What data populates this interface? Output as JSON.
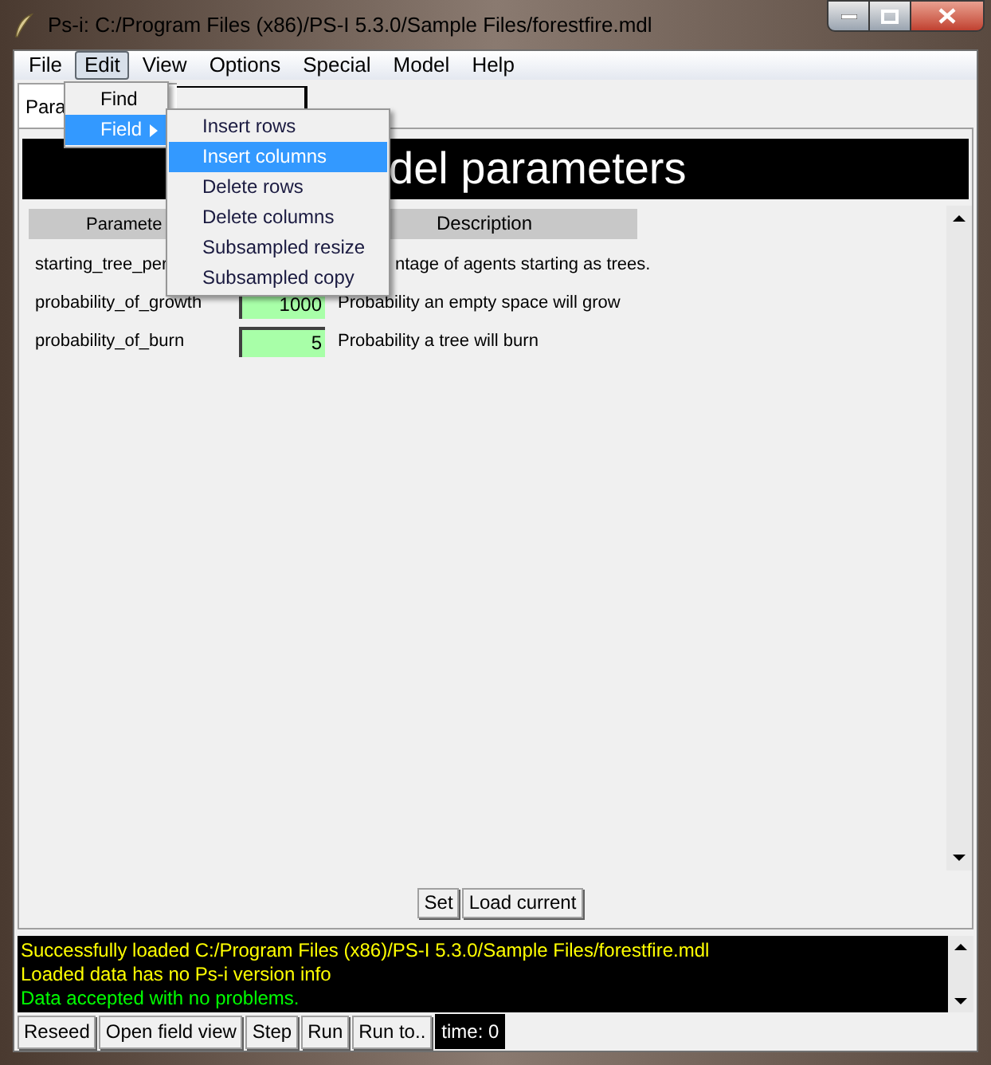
{
  "window": {
    "title": "Ps-i: C:/Program Files (x86)/PS-I 5.3.0/Sample Files/forestfire.mdl"
  },
  "menu_bar": [
    {
      "label": "File",
      "selected": false
    },
    {
      "label": "Edit",
      "selected": true
    },
    {
      "label": "View",
      "selected": false
    },
    {
      "label": "Options",
      "selected": false
    },
    {
      "label": "Special",
      "selected": false
    },
    {
      "label": "Model",
      "selected": false
    },
    {
      "label": "Help",
      "selected": false
    }
  ],
  "edit_menu": [
    {
      "label": "Find",
      "selected": false,
      "submenu": false
    },
    {
      "label": "Field",
      "selected": true,
      "submenu": true
    }
  ],
  "field_submenu": [
    {
      "label": "Insert rows",
      "selected": false
    },
    {
      "label": "Insert columns",
      "selected": true
    },
    {
      "label": "Delete rows",
      "selected": false
    },
    {
      "label": "Delete columns",
      "selected": false
    },
    {
      "label": "Subsampled resize",
      "selected": false
    },
    {
      "label": "Subsampled copy",
      "selected": false
    }
  ],
  "tabs": [
    {
      "label": "Para",
      "selected": true
    },
    {
      "selected": false
    }
  ],
  "banner": {
    "title": "del parameters"
  },
  "parameter_table": {
    "columns": [
      "Paramete",
      "Description"
    ],
    "rows": [
      {
        "parameter": "starting_tree_per",
        "description": "ntage of agents starting as trees."
      },
      {
        "parameter": "probability_of_growth",
        "value": "1000",
        "description": "Probability an empty space will grow"
      },
      {
        "parameter": "probability_of_burn",
        "value": "5",
        "description": "Probability a tree will burn"
      }
    ]
  },
  "buttons": [
    "Set",
    "Load current"
  ],
  "log": [
    {
      "text": "Successfully loaded C:/Program Files (x86)/PS-I 5.3.0/Sample Files/forestfire.mdl",
      "kind": "info"
    },
    {
      "text": "Loaded data has no Ps-i version info",
      "kind": "info"
    },
    {
      "text": "Data accepted with no problems.",
      "kind": "success"
    }
  ],
  "toolbar": [
    "Reseed",
    "Open field view",
    "Step",
    "Run",
    "Run to.."
  ],
  "time": "time: 0"
}
